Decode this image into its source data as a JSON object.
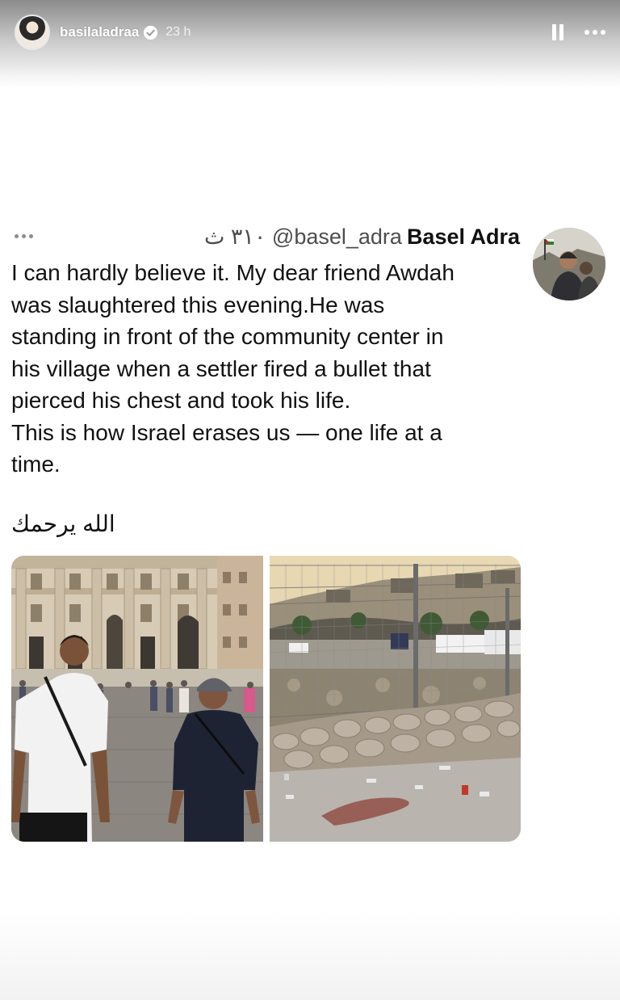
{
  "story": {
    "username": "basilaladraa",
    "time": "23 h",
    "icons": {
      "avatar": "profile-avatar",
      "verified": "verified-badge-icon",
      "pause": "pause-icon",
      "more": "more-dots-icon"
    }
  },
  "tweet": {
    "author_name": "Basel Adra",
    "handle_meta": "٣١٠ ث @basel_adra",
    "text": "I can hardly believe it. My dear friend Awdah\nwas slaughtered this evening.He was\nstanding in front of the community center in\nhis village when a settler fired a bullet that\npierced his chest and took his life.\nThis is how Israel erases us — one life at a\ntime.",
    "arabic_text": "الله يرحمك",
    "media": [
      "photo-two-men-at-plaza",
      "photo-fence-and-stones"
    ]
  },
  "colors": {
    "text": "#111111",
    "meta": "#4d4d4d",
    "story_text": "#ffffff"
  }
}
